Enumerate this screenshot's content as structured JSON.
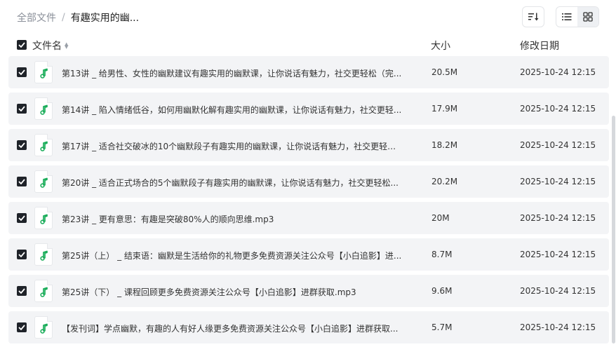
{
  "breadcrumb": {
    "root": "全部文件",
    "separator": "/",
    "current": "有趣实用的幽..."
  },
  "toolbar": {
    "sort_icon": "sort-icon",
    "view_modes": [
      "list-view-icon",
      "grid-view-icon"
    ],
    "active_view": "list"
  },
  "columns": {
    "name": "文件名",
    "size": "大小",
    "modified": "修改日期"
  },
  "accent_color": "#1aad5a",
  "files": [
    {
      "name": "第13讲 _ 给男性、女性的幽默建议有趣实用的幽默课，让你说话有魅力，社交更轻松（完...",
      "size": "20.5M",
      "modified": "2025-10-24 12:15"
    },
    {
      "name": "第14讲 _ 陷入情绪低谷，如何用幽默化解有趣实用的幽默课，让你说话有魅力，社交更轻...",
      "size": "17.9M",
      "modified": "2025-10-24 12:15"
    },
    {
      "name": "第17讲 _ 适合社交破冰的10个幽默段子有趣实用的幽默课，让你说话有魅力，社交更轻松...",
      "size": "18.2M",
      "modified": "2025-10-24 12:15"
    },
    {
      "name": "第20讲 _ 适合正式场合的5个幽默段子有趣实用的幽默课，让你说话有魅力，社交更轻松...",
      "size": "20.2M",
      "modified": "2025-10-24 12:15"
    },
    {
      "name": "第23讲 _ 更有意思：有趣是突破80%人的顺向思维.mp3",
      "size": "20M",
      "modified": "2025-10-24 12:15"
    },
    {
      "name": "第25讲（上） _ 结束语：幽默是生活给你的礼物更多免费资源关注公众号【小白追影】进...",
      "size": "8.7M",
      "modified": "2025-10-24 12:15"
    },
    {
      "name": "第25讲（下） _ 课程回顾更多免费资源关注公众号【小白追影】进群获取.mp3",
      "size": "9.6M",
      "modified": "2025-10-24 12:15"
    },
    {
      "name": "【发刊词】学点幽默，有趣的人有好人缘更多免费资源关注公众号【小白追影】进群获取...",
      "size": "5.7M",
      "modified": "2025-10-24 12:15"
    }
  ]
}
